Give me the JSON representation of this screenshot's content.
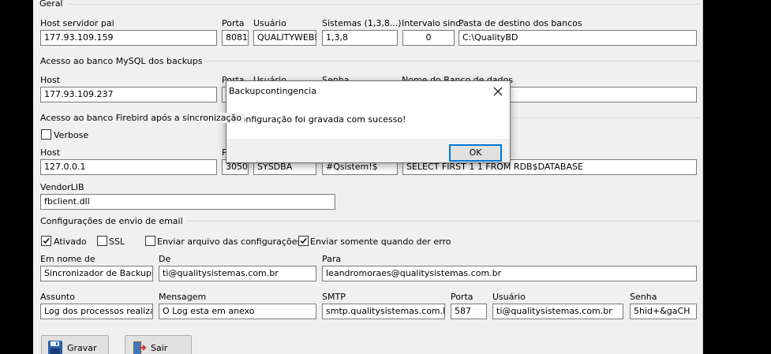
{
  "general": {
    "section_title": "Geral",
    "host_label": "Host servidor pai",
    "host_value": "177.93.109.159",
    "port_label": "Porta",
    "port_value": "8081",
    "user_label": "Usuário",
    "user_value": "QUALITYWEBEX",
    "systems_label": "Sistemas (1,3,8...)",
    "systems_value": "1,3,8",
    "interval_label": "Intervalo sinc.",
    "interval_value": "0",
    "dest_label": "Pasta de destino dos bancos",
    "dest_value": "C:\\QualityBD"
  },
  "mysql": {
    "section_title": "Acesso ao banco MySQL dos backups",
    "host_label": "Host",
    "host_value": "177.93.109.237",
    "port_label": "Porta",
    "user_label": "Usuário",
    "password_label": "Senha",
    "dbname_label": "Nome do Banco de dados"
  },
  "firebird": {
    "section_title": "Acesso ao banco Firebird após a sincronização",
    "verbose_label": "Verbose",
    "host_label": "Host",
    "host_value": "127.0.0.1",
    "port_fragment": "P",
    "port_value": "3050",
    "user_value": "SYSDBA",
    "password_value": "#Qsistem!$",
    "sql_value": "SELECT FIRST 1 1 FROM RDB$DATABASE",
    "vendorlib_label": "VendorLIB",
    "vendorlib_value": "fbclient.dll"
  },
  "email": {
    "section_title": "Configurações de envio de email",
    "enabled_label": "Ativado",
    "ssl_label": "SSL",
    "send_config_label": "Enviar arquivo das configurações",
    "send_on_error_label": "Enviar somente quando der erro",
    "enabled_checked": true,
    "ssl_checked": false,
    "send_config_checked": false,
    "send_on_error_checked": true,
    "name_label": "Em nome de",
    "name_value": "Sincronizador de Backups do",
    "from_label": "De",
    "from_value": "ti@qualitysistemas.com.br",
    "to_label": "Para",
    "to_value": "leandromoraes@qualitysistemas.com.br",
    "subject_label": "Assunto",
    "subject_value": "Log dos processos realizados",
    "message_label": "Mensagem",
    "message_value": "O Log esta em anexo",
    "smtp_label": "SMTP",
    "smtp_value": "smtp.qualitysistemas.com.br",
    "smtp_port_label": "Porta",
    "smtp_port_value": "587",
    "smtp_user_label": "Usuário",
    "smtp_user_value": "ti@qualitysistemas.com.br",
    "smtp_password_label": "Senha",
    "smtp_password_value": "5hid+&gaCH"
  },
  "actions": {
    "save_label": "Gravar",
    "exit_label": "Sair"
  },
  "dialog": {
    "title": "Backupcontingencia",
    "message": "Configuração foi gravada com sucesso!",
    "ok_label": "OK"
  }
}
